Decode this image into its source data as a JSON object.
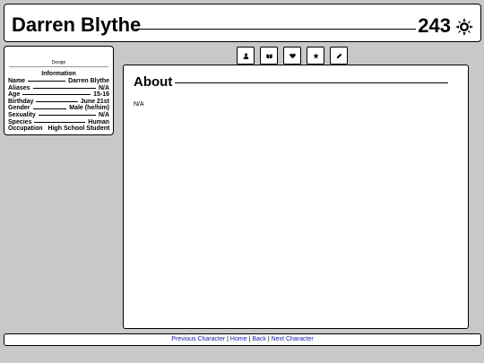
{
  "character": {
    "name": "Darren Blythe",
    "number": "243",
    "icon": "sun-icon"
  },
  "sidebar": {
    "design_label": "Design",
    "info_title": "Information",
    "rows": [
      {
        "key": "Name",
        "value": "Darren Blythe"
      },
      {
        "key": "Aliases",
        "value": "N/A"
      },
      {
        "key": "Age",
        "value": "15-16"
      },
      {
        "key": "Birthday",
        "value": "June 21st"
      },
      {
        "key": "Gender",
        "value": "Male (he/him)"
      },
      {
        "key": "Sexuality",
        "value": "N/A"
      },
      {
        "key": "Species",
        "value": "Human"
      },
      {
        "key": "Occupation",
        "value": "High School Student"
      }
    ]
  },
  "tabs": [
    {
      "icon": "user-icon"
    },
    {
      "icon": "book-icon"
    },
    {
      "icon": "heart-icon"
    },
    {
      "icon": "star-icon"
    },
    {
      "icon": "pencil-icon"
    }
  ],
  "main": {
    "section_title": "About",
    "body": "N/A"
  },
  "footer": {
    "prev": "Previous Character",
    "home": "Home",
    "back": "Back",
    "next": "Next Character",
    "separator": "|"
  },
  "colors": {
    "background": "#c8c8c8",
    "link": "#1a1aa6"
  }
}
